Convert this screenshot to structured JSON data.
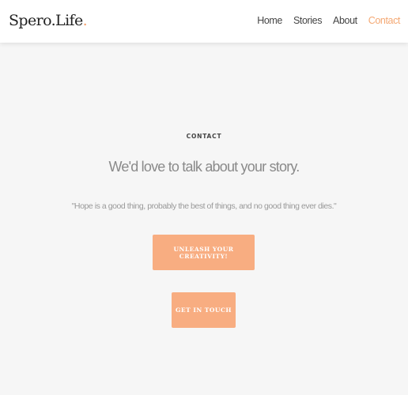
{
  "header": {
    "brand": "Spero.Life",
    "brand_dot": ".",
    "nav": [
      {
        "label": "Home"
      },
      {
        "label": "Stories"
      },
      {
        "label": "About"
      },
      {
        "label": "Contact",
        "active": true
      }
    ]
  },
  "contact": {
    "section_label": "CONTACT",
    "headline": "We'd love to talk about your story.",
    "quote": "\"Hope is a good thing, probably the best of things, and no good thing ever dies.\"",
    "primary_button": "UNLEASH YOUR CREATIVITY!",
    "secondary_button": "GET IN TOUCH"
  },
  "colors": {
    "accent": "#f8ad81",
    "active_nav": "#f4a873",
    "background": "#f6f6f6",
    "header_bg": "#ffffff"
  }
}
